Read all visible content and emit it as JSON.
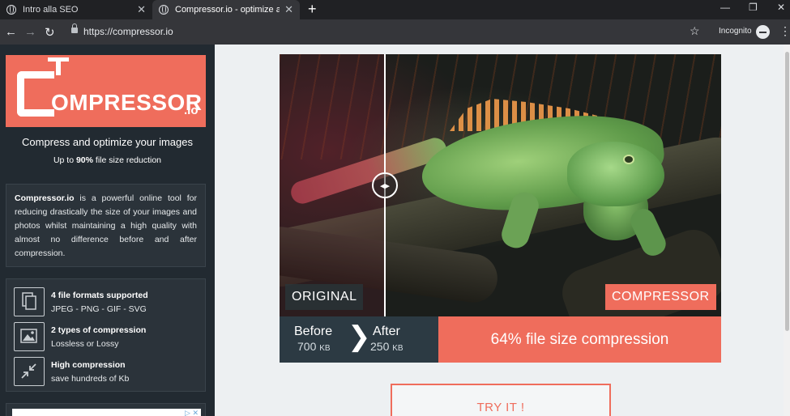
{
  "browser": {
    "tabs": [
      {
        "title": "Intro alla SEO",
        "close": "✕"
      },
      {
        "title": "Compressor.io - optimize and co",
        "close": "✕"
      }
    ],
    "new_tab": "+",
    "window_controls": {
      "minimize": "—",
      "restore": "❐",
      "close": "✕"
    },
    "nav": {
      "back": "←",
      "forward": "→",
      "reload": "↻"
    },
    "url": "https://compressor.io",
    "bookmark": "☆",
    "incognito_label": "Incognito",
    "menu": "⋮"
  },
  "sidebar": {
    "logo_text": "OMPRESSOR",
    "logo_suffix": ".io",
    "tagline": "Compress and optimize your images",
    "subtag_prefix": "Up to ",
    "subtag_bold": "90%",
    "subtag_suffix": " file size reduction",
    "description_bold": "Compressor.io",
    "description": " is a powerful online tool for reducing drastically the size of your images and photos whilst maintaining a high quality with almost no difference before and after compression.",
    "features": [
      {
        "icon": "file-formats-icon",
        "title": "4 file formats supported",
        "subtitle": "JPEG - PNG - GIF - SVG"
      },
      {
        "icon": "image-icon",
        "title": "2 types of compression",
        "subtitle": "Lossless or Lossy"
      },
      {
        "icon": "compress-arrows-icon",
        "title": "High compression",
        "subtitle": "save hundreds of Kb"
      }
    ],
    "ad_icons": "▷ ✕"
  },
  "comparison": {
    "label_original": "ORIGINAL",
    "label_compressor": "COMPRESSOR",
    "handle": "◂▸",
    "before_label": "Before",
    "before_value": "700",
    "before_unit": "KB",
    "after_label": "After",
    "after_value": "250",
    "after_unit": "KB",
    "arrow": "❯",
    "result": "64% file size compression"
  },
  "cta": {
    "label": "TRY IT !"
  },
  "colors": {
    "accent": "#ef6d5c",
    "sidebar": "#222a31",
    "page": "#edf0f2"
  }
}
